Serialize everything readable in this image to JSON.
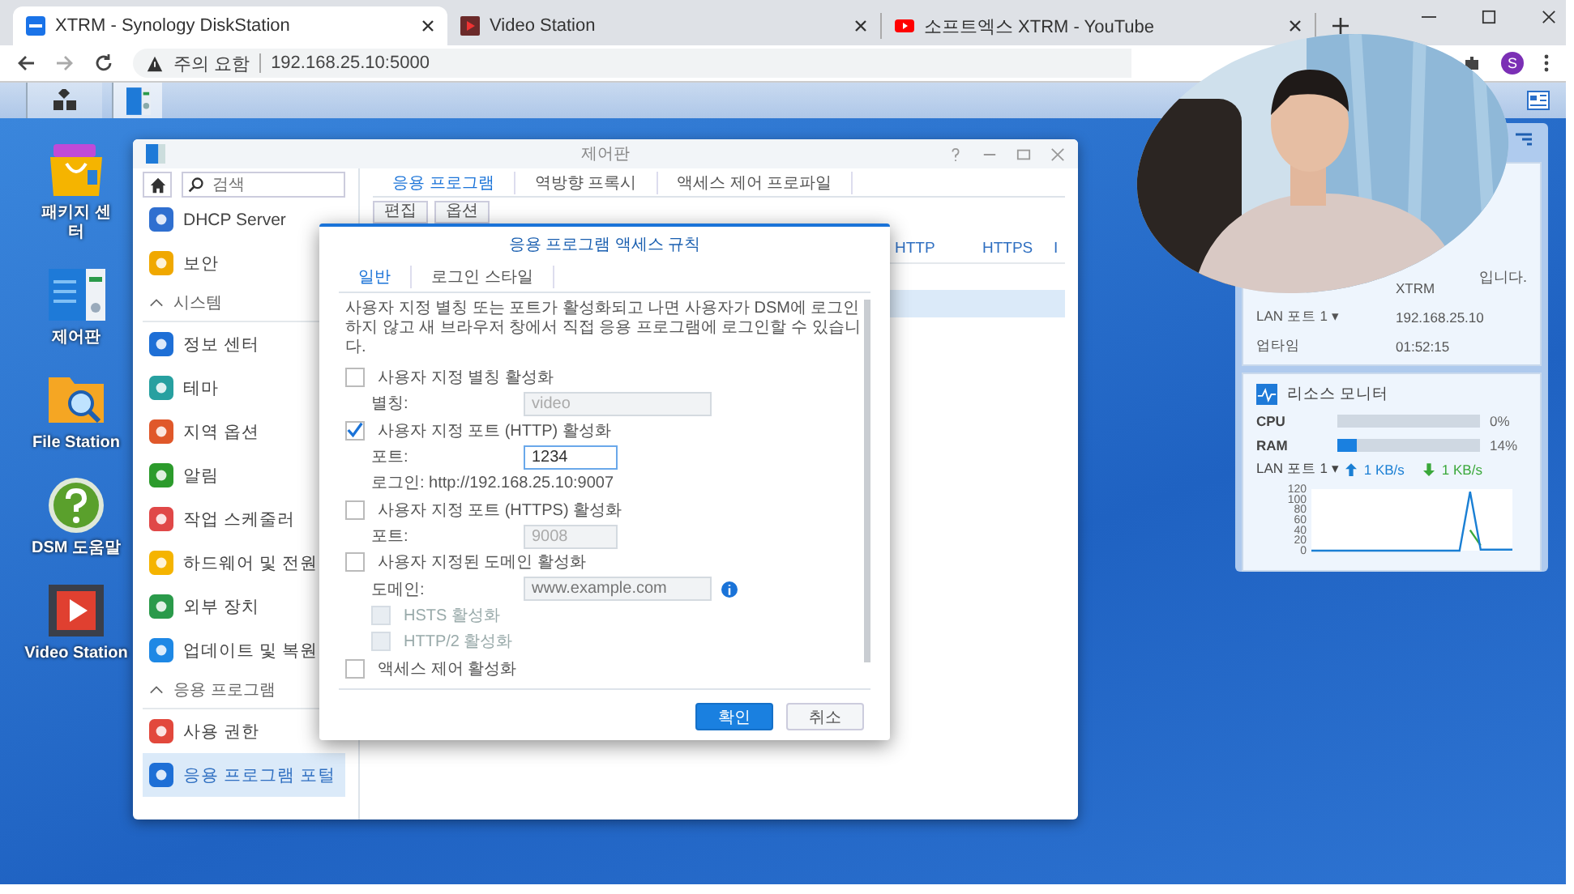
{
  "browser": {
    "tabs": [
      {
        "title": "XTRM - Synology DiskStation",
        "selected": true
      },
      {
        "title": "Video Station",
        "selected": false
      },
      {
        "title": "소프트엑스 XTRM - YouTube",
        "selected": false
      }
    ],
    "security": "주의 요함",
    "url": "192.168.25.10:5000",
    "profile": "S"
  },
  "taskbar": {
    "apps": [
      {
        "selected": false
      },
      {
        "selected": true
      }
    ]
  },
  "desktop": {
    "icons": [
      "패키지 센터",
      "제어판",
      "File Station",
      "DSM 도움말",
      "Video Station"
    ]
  },
  "control_panel": {
    "title": "제어판",
    "search": {
      "placeholder": "검색"
    },
    "sidebar": [
      {
        "kind": "item",
        "label": "DHCP Server",
        "selected": false
      },
      {
        "kind": "item",
        "label": "보안",
        "selected": false
      },
      {
        "kind": "section",
        "label": "시스템"
      },
      {
        "kind": "item",
        "label": "정보 센터",
        "selected": false
      },
      {
        "kind": "item",
        "label": "테마",
        "selected": false
      },
      {
        "kind": "item",
        "label": "지역 옵션",
        "selected": false
      },
      {
        "kind": "item",
        "label": "알림",
        "selected": false
      },
      {
        "kind": "item",
        "label": "작업 스케줄러",
        "selected": false
      },
      {
        "kind": "item",
        "label": "하드웨어 및 전원",
        "selected": false
      },
      {
        "kind": "item",
        "label": "외부 장치",
        "selected": false
      },
      {
        "kind": "item",
        "label": "업데이트 및 복원",
        "selected": false
      },
      {
        "kind": "section",
        "label": "응용 프로그램"
      },
      {
        "kind": "item",
        "label": "사용 권한",
        "selected": false
      },
      {
        "kind": "item",
        "label": "응용 프로그램 포털",
        "selected": true
      }
    ],
    "tabs": [
      {
        "label": "응용 프로그램",
        "selected": true
      },
      {
        "label": "역방향 프록시",
        "selected": false
      },
      {
        "label": "액세스 제어 프로파일",
        "selected": false
      }
    ],
    "toolbar": [
      "편집",
      "옵션"
    ],
    "table": {
      "columns": [
        "HTTP",
        "HTTPS",
        "I"
      ],
      "rows": [
        {
          "selected": true
        }
      ]
    }
  },
  "dialog": {
    "title": "응용 프로그램 액세스 규칙",
    "tabs": [
      {
        "label": "일반",
        "selected": true
      },
      {
        "label": "로그인 스타일",
        "selected": false
      }
    ],
    "description": "사용자 지정 별칭 또는 포트가 활성화되고 나면 사용자가 DSM에 로그인하지 않고 새 브라우저 창에서 직접 응용 프로그램에 로그인할 수 있습니다.",
    "rows": [
      {
        "kind": "checkbox",
        "label": "사용자 지정 별칭 활성화",
        "checked": false
      },
      {
        "kind": "field",
        "label": "별칭:",
        "value": "video",
        "disabled": true
      },
      {
        "kind": "checkbox",
        "label": "사용자 지정 포트 (HTTP) 활성화",
        "checked": true
      },
      {
        "kind": "field",
        "label": "포트:",
        "value": "1234",
        "disabled": false
      },
      {
        "kind": "note",
        "label": "로그인: http://192.168.25.10:9007"
      },
      {
        "kind": "checkbox",
        "label": "사용자 지정 포트 (HTTPS) 활성화",
        "checked": false
      },
      {
        "kind": "field",
        "label": "포트:",
        "value": "9008",
        "disabled": true
      },
      {
        "kind": "checkbox",
        "label": "사용자 지정된 도메인 활성화",
        "checked": false
      },
      {
        "kind": "field",
        "label": "도메인:",
        "placeholder": "www.example.com",
        "disabled": true,
        "info": true
      },
      {
        "kind": "subcheckbox",
        "label": "HSTS 활성화",
        "checked": false,
        "disabled": true
      },
      {
        "kind": "subcheckbox",
        "label": "HTTP/2 활성화",
        "checked": false,
        "disabled": true
      },
      {
        "kind": "checkbox",
        "label": "액세스 제어 활성화",
        "checked": false
      }
    ],
    "buttons": [
      {
        "label": "확인",
        "kind": "primary"
      },
      {
        "label": "취소",
        "kind": "secondary"
      }
    ]
  },
  "widgets": {
    "system": {
      "fragment": "입니다.",
      "server": "XTRM",
      "rows": [
        {
          "label": "LAN 포트 1 ▾",
          "value": "192.168.25.10"
        },
        {
          "label": "업타임",
          "value": "01:52:15"
        }
      ]
    },
    "resource": {
      "title": "리소스 모니터",
      "meters": [
        {
          "name": "CPU",
          "level": 0,
          "reading": "0%"
        },
        {
          "name": "RAM",
          "level": 0.14,
          "reading": "14%"
        }
      ],
      "lan": {
        "label": "LAN 포트 1 ▾",
        "up": "1 KB/s",
        "down": "1 KB/s"
      },
      "chart_data": {
        "type": "line",
        "ylim": [
          0,
          120
        ],
        "yticks": [
          0,
          20,
          40,
          60,
          80,
          100,
          120
        ],
        "series": [
          {
            "color": "#3aa83a",
            "values": [
              null,
              null,
              null,
              null,
              null,
              null,
              null,
              null,
              null,
              null,
              null,
              null,
              null,
              null,
              null,
              40,
              10,
              null,
              null,
              null
            ]
          },
          {
            "color": "#1a7fd4",
            "values": [
              0,
              0,
              0,
              0,
              0,
              0,
              0,
              0,
              0,
              0,
              0,
              0,
              0,
              0,
              0,
              115,
              2,
              2,
              2,
              2
            ]
          }
        ]
      }
    }
  }
}
